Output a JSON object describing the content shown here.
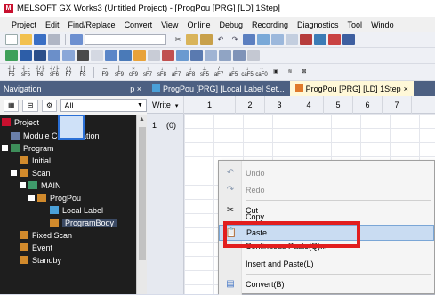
{
  "window": {
    "title": "MELSOFT GX Works3 (Untitled Project) - [ProgPou [PRG] [LD] 1Step]",
    "icon_text": "M"
  },
  "menubar": [
    "Project",
    "Edit",
    "Find/Replace",
    "Convert",
    "View",
    "Online",
    "Debug",
    "Recording",
    "Diagnostics",
    "Tool",
    "Windo"
  ],
  "navigation": {
    "header": "Navigation",
    "header_controls": "p ×",
    "filter_value": "All",
    "tree": [
      {
        "label": "Project",
        "level": 0,
        "icon": "project-icon"
      },
      {
        "label": "Module Configuration",
        "level": 1,
        "icon": "module-config-icon"
      },
      {
        "label": "Program",
        "level": 0,
        "icon": "program-folder-icon"
      },
      {
        "label": "Initial",
        "level": 1,
        "icon": "folder-icon"
      },
      {
        "label": "Scan",
        "level": 1,
        "icon": "folder-icon"
      },
      {
        "label": "MAIN",
        "level": 2,
        "icon": "task-icon"
      },
      {
        "label": "ProgPou",
        "level": 3,
        "icon": "program-icon"
      },
      {
        "label": "Local Label",
        "level": 4,
        "icon": "label-icon"
      },
      {
        "label": "ProgramBody",
        "level": 4,
        "icon": "program-body-icon"
      },
      {
        "label": "Fixed Scan",
        "level": 1,
        "icon": "folder-icon"
      },
      {
        "label": "Event",
        "level": 1,
        "icon": "folder-icon"
      },
      {
        "label": "Standby",
        "level": 1,
        "icon": "folder-icon"
      }
    ]
  },
  "tabs": [
    {
      "label": "ProgPou [PRG] [Local Label Set..."
    },
    {
      "label": "ProgPou [PRG] [LD] 1Step",
      "close": "×"
    }
  ],
  "editor": {
    "mode": "Write",
    "columns": [
      "1",
      "2",
      "3",
      "4",
      "5",
      "6",
      "7"
    ],
    "row_number": "1",
    "step": "(0)"
  },
  "context_menu": {
    "items": [
      {
        "label": "Undo",
        "icon": "undo-icon",
        "disabled": true
      },
      {
        "label": "Redo",
        "icon": "redo-icon",
        "disabled": true
      },
      {
        "label": "Cut",
        "icon": "cut-icon",
        "disabled": false
      },
      {
        "label": "Copy",
        "icon": "copy-icon",
        "disabled": false
      },
      {
        "label": "Paste",
        "icon": "paste-icon",
        "disabled": false,
        "highlighted": true
      },
      {
        "label": "Continuous Paste(Q)...",
        "icon": "",
        "disabled": false
      },
      {
        "label": "Insert and Paste(L)",
        "icon": "",
        "disabled": false
      },
      {
        "label": "Convert(B)",
        "icon": "convert-icon",
        "disabled": false
      }
    ]
  },
  "colors": {
    "highlight_border": "#e21e1e",
    "nav_header": "#4d6082",
    "tree_bg": "#1e1e1e"
  }
}
